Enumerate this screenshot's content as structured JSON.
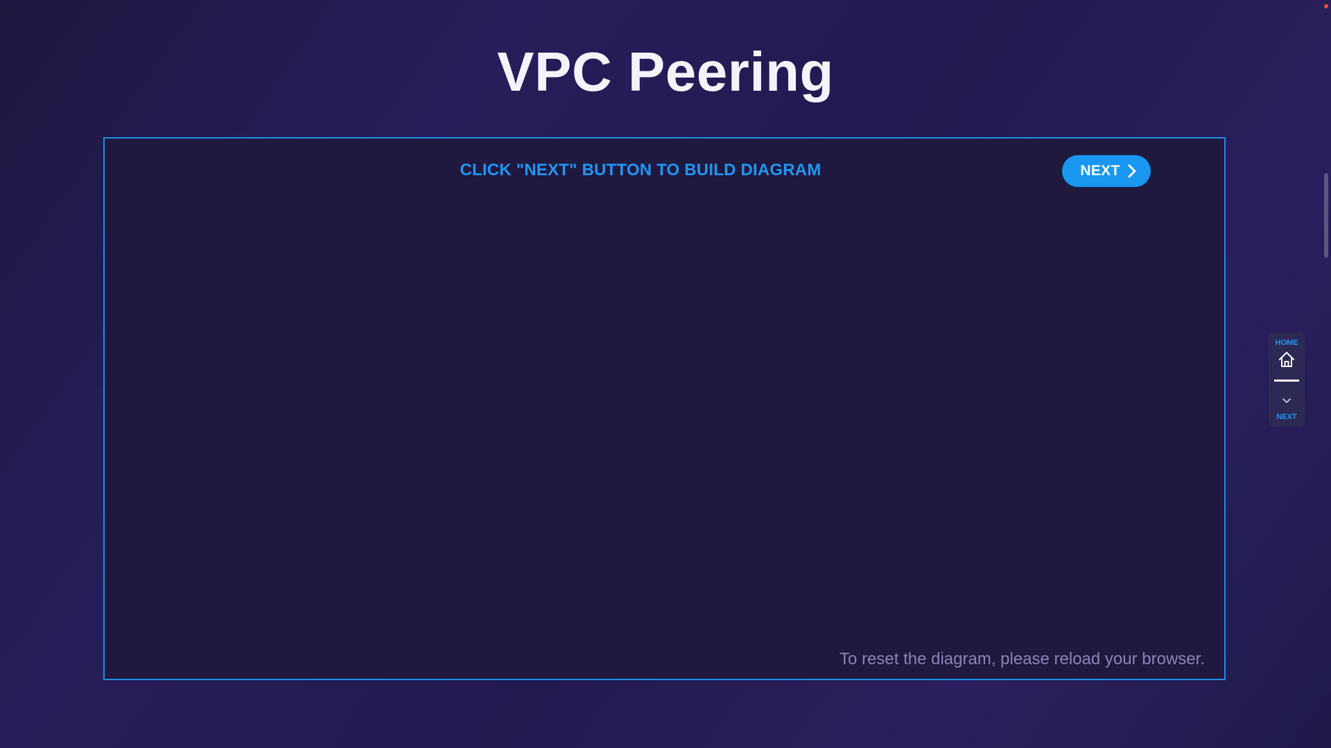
{
  "page": {
    "title": "VPC Peering"
  },
  "diagram": {
    "instruction": "CLICK \"NEXT\" BUTTON TO BUILD DIAGRAM",
    "next_button_label": "NEXT",
    "reset_note": "To reset the diagram, please reload your browser."
  },
  "side_nav": {
    "home_label": "HOME",
    "home_icon": "home-icon",
    "next_label": "NEXT",
    "next_icon": "chevron-down-icon"
  },
  "colors": {
    "accent": "#2196f3",
    "button": "#1896f0",
    "frame_border": "#1f8fe6",
    "background": "#231b50"
  }
}
